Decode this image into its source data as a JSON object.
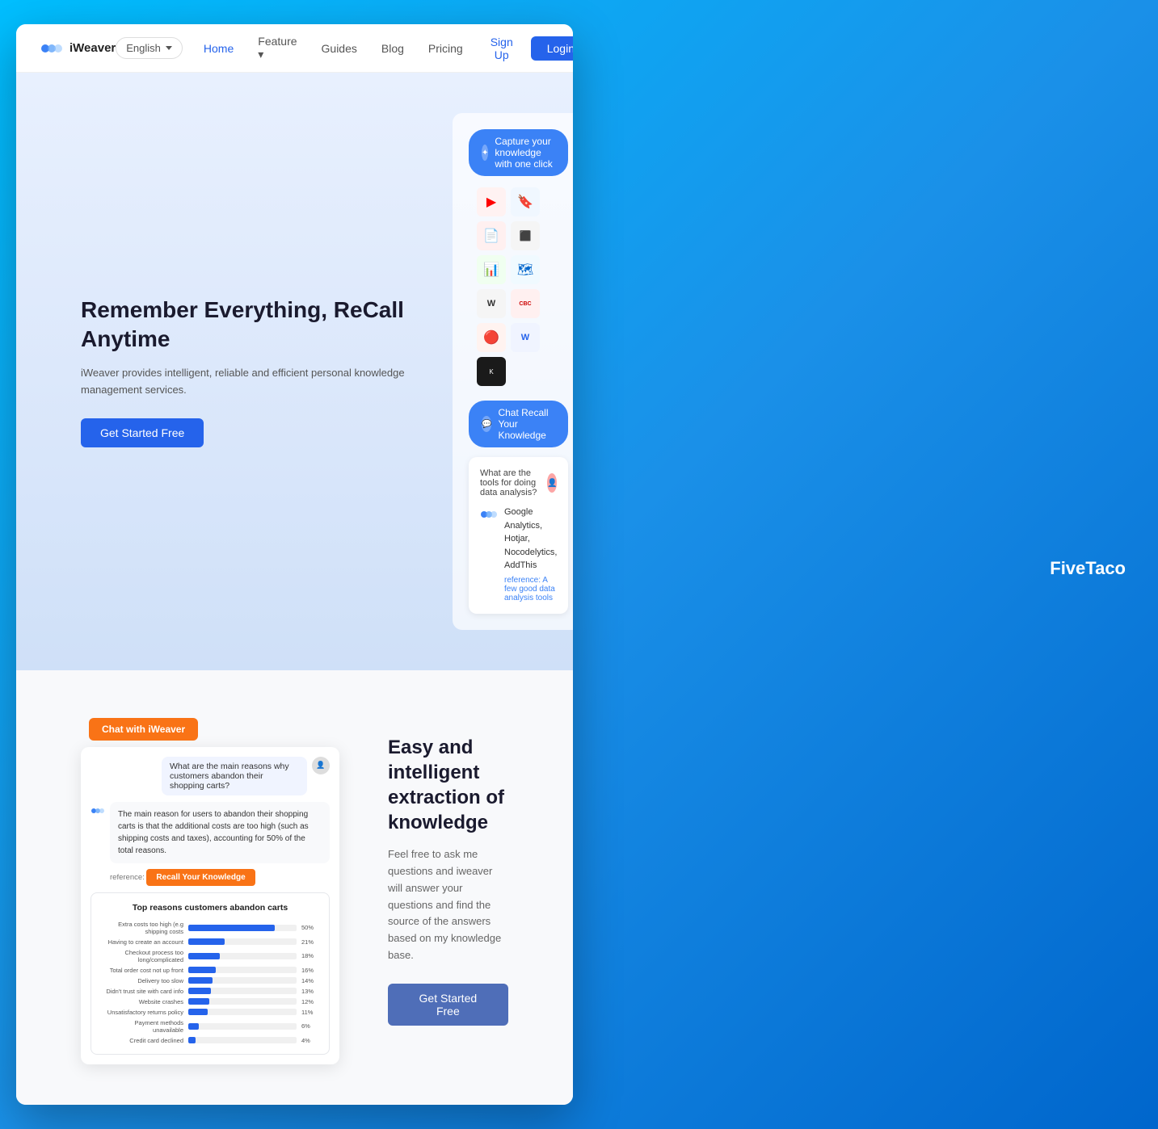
{
  "navbar": {
    "logo_text": "iWeaver",
    "lang": "English",
    "nav_items": [
      {
        "label": "Home",
        "active": true
      },
      {
        "label": "Feature",
        "has_dropdown": true
      },
      {
        "label": "Guides"
      },
      {
        "label": "Blog"
      },
      {
        "label": "Pricing"
      }
    ],
    "signup_label": "Sign Up",
    "login_label": "Login"
  },
  "hero": {
    "title": "Remember Everything, ReCall Anytime",
    "description": "iWeaver provides intelligent, reliable and efficient personal knowledge management services.",
    "cta_label": "Get Started Free",
    "capture_pill": "Capture your knowledge with one click",
    "chat_pill": "Chat Recall Your Knowledge",
    "chat_question": "What are the tools for doing data analysis?",
    "chat_answer": "Google Analytics, Hotjar, Nocodelytics, AddThis",
    "chat_reference_label": "reference:",
    "chat_reference_link": "A few good data analysis tools"
  },
  "section2": {
    "chat_tag": "Chat with iWeaver",
    "user_question": "What are the main reasons why customers abandon their shopping carts?",
    "ai_answer": "The main reason for users to abandon their shopping carts is that the additional costs are too high (such as shipping costs and taxes), accounting for 50% of the total reasons.",
    "ai_reference_label": "reference:",
    "recall_tag": "Recall Your Knowledge",
    "chart_title": "Top reasons customers abandon carts",
    "chart_data": [
      {
        "label": "Extra costs too high (e.g shipping costs",
        "value": 50,
        "display": "50%"
      },
      {
        "label": "Having to create an account",
        "value": 21,
        "display": "21%"
      },
      {
        "label": "Checkout process too long/complicated",
        "value": 18,
        "display": "18%"
      },
      {
        "label": "Total order cost not up front",
        "value": 16,
        "display": "16%"
      },
      {
        "label": "Delivery too slow",
        "value": 14,
        "display": "14%"
      },
      {
        "label": "Didn't trust site with card info",
        "value": 13,
        "display": "13%"
      },
      {
        "label": "Website crashes",
        "value": 12,
        "display": "12%"
      },
      {
        "label": "Unsatisfactory returns policy",
        "value": 11,
        "display": "11%"
      },
      {
        "label": "Payment methods unavailable",
        "value": 6,
        "display": "6%"
      },
      {
        "label": "Credit card declined",
        "value": 4,
        "display": "4%"
      }
    ],
    "title": "Easy and intelligent extraction of knowledge",
    "description": "Feel free to ask me questions and iweaver will answer your questions and find the source of the answers based on my knowledge base.",
    "cta_label": "Get Started Free"
  },
  "footer": {
    "brand": "FiveTaco"
  },
  "icons": {
    "yt": "▶",
    "bookmark": "🔖",
    "pdf": "📄",
    "notion": "⬛",
    "sheets": "📊",
    "map": "🗺",
    "wiki": "W",
    "cbc": "CBC",
    "reddit": "🔴",
    "word": "W",
    "dark": "⬤"
  }
}
